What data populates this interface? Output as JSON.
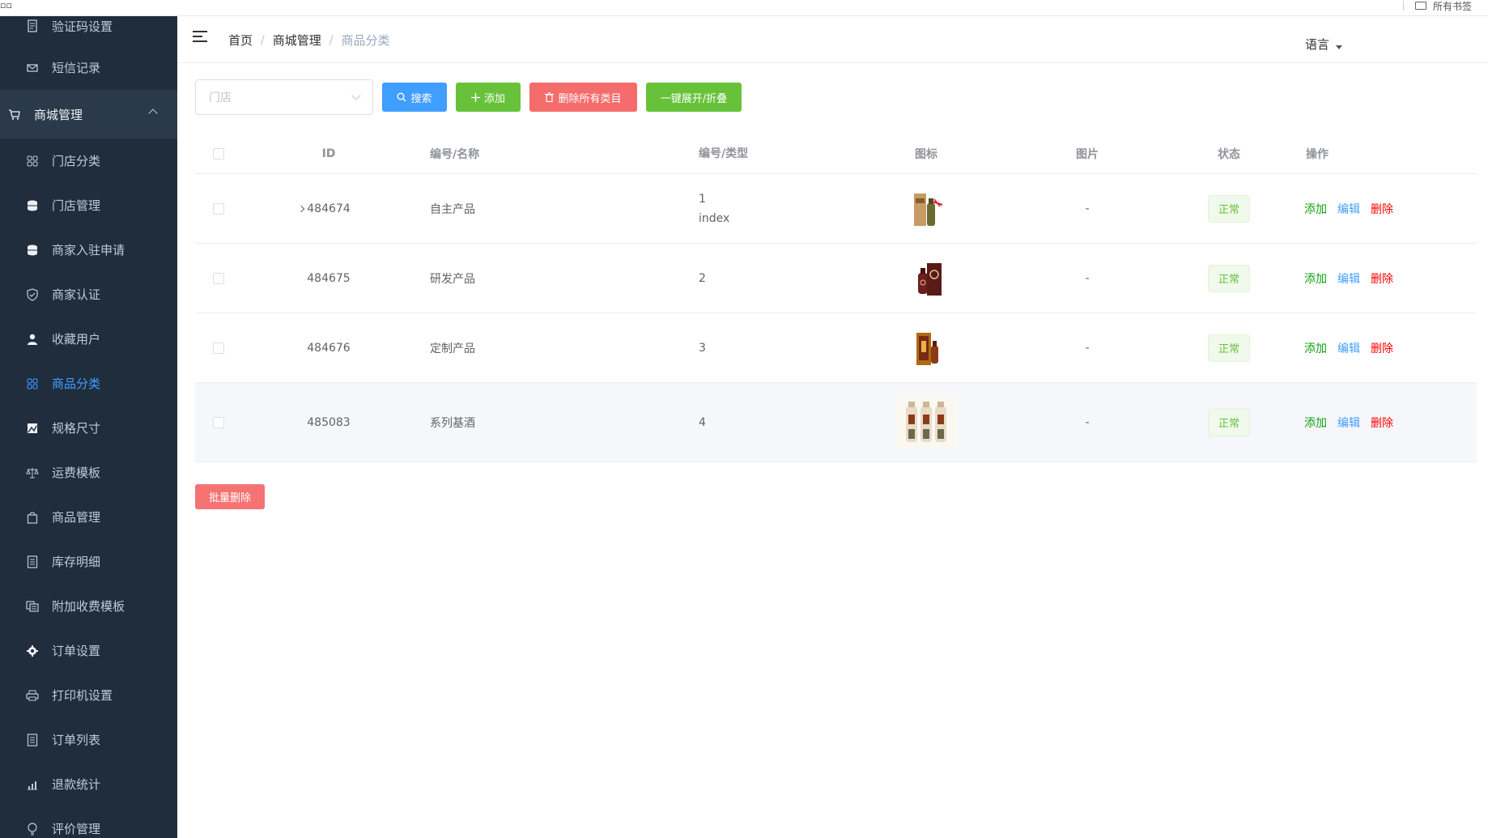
{
  "topbar": {
    "corner": "▫▫",
    "bookmarks_label": "所有书签"
  },
  "sidebar": {
    "items_top": [
      {
        "label": "验证码设置",
        "icon": "document-icon"
      },
      {
        "label": "短信记录",
        "icon": "mail-icon"
      }
    ],
    "group": {
      "label": "商城管理",
      "icon": "cart-icon"
    },
    "items": [
      {
        "label": "门店分类",
        "icon": "grid-icon"
      },
      {
        "label": "门店管理",
        "icon": "database-icon"
      },
      {
        "label": "商家入驻申请",
        "icon": "database-icon"
      },
      {
        "label": "商家认证",
        "icon": "shield-icon"
      },
      {
        "label": "收藏用户",
        "icon": "user-icon"
      },
      {
        "label": "商品分类",
        "icon": "grid-icon",
        "active": true
      },
      {
        "label": "规格尺寸",
        "icon": "picture-icon"
      },
      {
        "label": "运费模板",
        "icon": "scale-icon"
      },
      {
        "label": "商品管理",
        "icon": "bag-icon"
      },
      {
        "label": "库存明细",
        "icon": "list-icon"
      },
      {
        "label": "附加收费模板",
        "icon": "copy-icon"
      },
      {
        "label": "订单设置",
        "icon": "gear-icon"
      },
      {
        "label": "打印机设置",
        "icon": "printer-icon"
      },
      {
        "label": "订单列表",
        "icon": "list-icon"
      },
      {
        "label": "退款统计",
        "icon": "chart-icon"
      },
      {
        "label": "评价管理",
        "icon": "bulb-icon"
      }
    ]
  },
  "header": {
    "breadcrumb": [
      "首页",
      "商城管理",
      "商品分类"
    ],
    "language": "语言"
  },
  "toolbar": {
    "store_placeholder": "门店",
    "search": "搜索",
    "add": "添加",
    "delete_all": "删除所有类目",
    "expand_collapse": "一键展开/折叠"
  },
  "table": {
    "columns": [
      "ID",
      "编号/名称",
      "编号/类型",
      "图标",
      "图片",
      "状态",
      "操作"
    ],
    "rows": [
      {
        "id": "484674",
        "name": "自主产品",
        "code": "1",
        "type": "index",
        "picture": "-",
        "status": "正常",
        "expandable": true
      },
      {
        "id": "484675",
        "name": "研发产品",
        "code": "2",
        "type": "",
        "picture": "-",
        "status": "正常",
        "expandable": false
      },
      {
        "id": "484676",
        "name": "定制产品",
        "code": "3",
        "type": "",
        "picture": "-",
        "status": "正常",
        "expandable": false
      },
      {
        "id": "485083",
        "name": "系列基酒",
        "code": "4",
        "type": "",
        "picture": "-",
        "status": "正常",
        "expandable": false
      }
    ],
    "ops": {
      "add": "添加",
      "edit": "编辑",
      "delete": "删除"
    }
  },
  "batch_delete": "批量删除",
  "colors": {
    "sidebar": "#1f2d3d",
    "primary": "#409eff",
    "success": "#67c23a",
    "danger": "#f56c6c"
  }
}
